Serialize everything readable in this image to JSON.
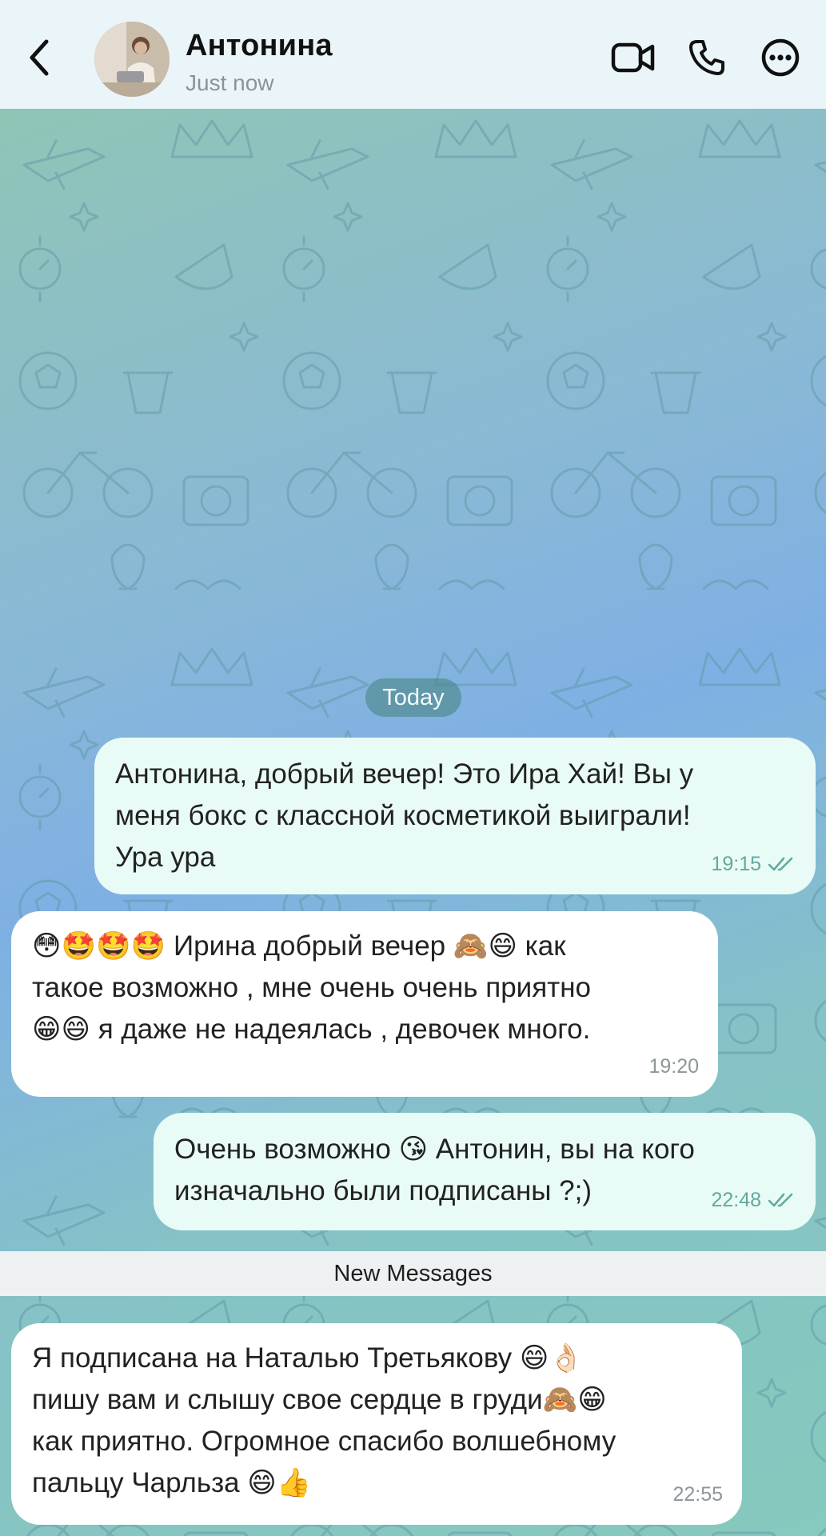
{
  "header": {
    "contact_name": "Антонина",
    "status": "Just now",
    "icons": {
      "back": "chevron-left-icon",
      "video": "video-camera-icon",
      "call": "phone-icon",
      "more": "more-dots-icon"
    }
  },
  "chat": {
    "date_separator": "Today",
    "new_messages_label": "New Messages",
    "messages": [
      {
        "direction": "outgoing",
        "text": "Антонина, добрый вечер! Это Ира Хай! Вы у\nменя бокс с классной косметикой выиграли!\nУра ура",
        "time": "19:15",
        "status": "read"
      },
      {
        "direction": "incoming",
        "text": "😳🤩🤩🤩 Ирина добрый вечер 🙈😄 как\nтакое возможно , мне очень очень приятно\n😁😄 я даже не надеялась  , девочек много.",
        "time": "19:20"
      },
      {
        "direction": "outgoing",
        "text": "Очень возможно 😘 Антонин, вы на кого\nизначально были подписаны ?;)",
        "time": "22:48",
        "status": "read"
      },
      {
        "direction": "incoming",
        "text": "Я подписана на Наталью Третьякову 😄👌🏻\nпишу вам и слышу свое сердце в груди🙈😁\nкак приятно. Огромное спасибо волшебному\nпальцу Чарльза 😄👍",
        "time": "22:55"
      }
    ]
  },
  "colors": {
    "header_bg": "#eaf5fa",
    "outgoing_bubble": "#e9fbf6",
    "incoming_bubble": "#ffffff",
    "read_check": "#63a89f"
  }
}
